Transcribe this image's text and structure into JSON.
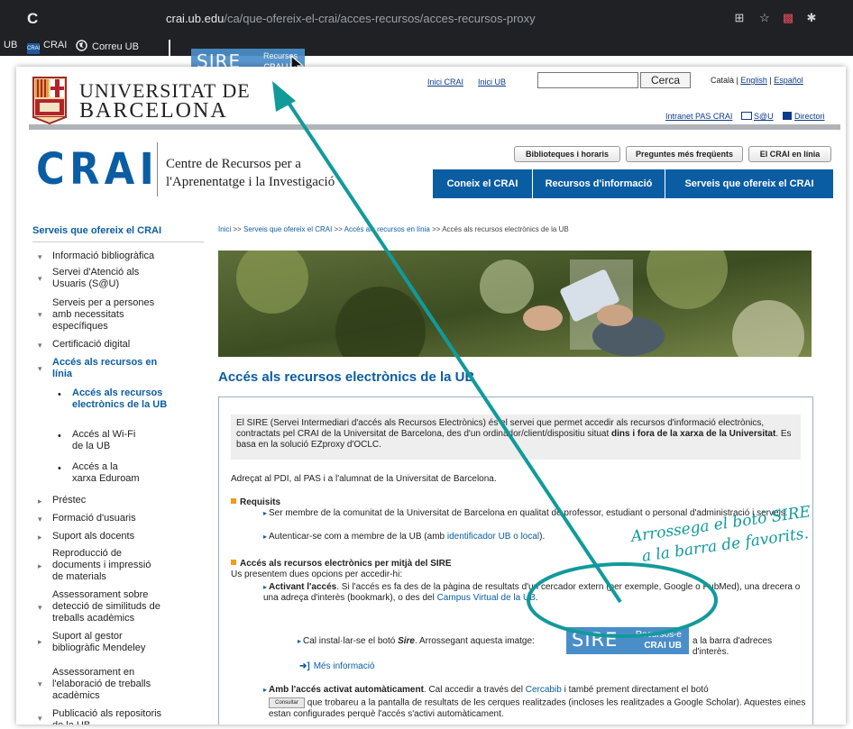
{
  "browser": {
    "url_domain": "crai.ub.edu",
    "url_path": "/ca/que-ofereix-el-crai/acces-recursos/acces-recursos-proxy",
    "bookmarks": [
      {
        "label": "UB",
        "icon": "ub-favicon"
      },
      {
        "label": "CRAI",
        "icon": "crai-favicon"
      },
      {
        "label": "Correu UB",
        "icon": "globe-icon"
      }
    ]
  },
  "dragged_button": {
    "main": "SIRE",
    "top": "Recursos",
    "bottom": "CRAI UB"
  },
  "header": {
    "university_line1": "UNIVERSITAT DE",
    "university_line2": "BARCELONA",
    "top_links": [
      "Inici CRAI",
      "Inici UB"
    ],
    "search_button": "Cerca",
    "search_value": "",
    "languages": [
      "Català",
      "English",
      "Español"
    ],
    "intranet": "Intranet PAS CRAI",
    "sau": "S@U",
    "directori": "Directori",
    "crai_logo": "CRAI",
    "crai_name_line1": "Centre de Recursos per a",
    "crai_name_line2": "l'Aprenentatge i la Investigació",
    "pills": [
      "Biblioteques i horaris",
      "Preguntes més freqüents",
      "El CRAI en línia"
    ],
    "main_nav": [
      "Coneix el CRAI",
      "Recursos d'informació",
      "Serveis que ofereix el CRAI"
    ]
  },
  "sidebar": {
    "title": "Serveis que ofereix el CRAI",
    "items": [
      {
        "label": "Informació bibliogràfica",
        "bullet": "▾"
      },
      {
        "label": "Servei d'Atenció als Usuaris (S@U)",
        "bullet": "▾"
      },
      {
        "label": "Serveis per a persones amb necessitats específiques",
        "bullet": "▾"
      },
      {
        "label": "Certificació digital",
        "bullet": "▾"
      },
      {
        "label": "Accés als recursos en línia",
        "bullet": "▾"
      },
      {
        "label": "Préstec",
        "bullet": "▸"
      },
      {
        "label": "Formació d'usuaris",
        "bullet": "▾"
      },
      {
        "label": "Suport als docents",
        "bullet": "▸"
      },
      {
        "label": "Reproducció de documents i impressió de materials",
        "bullet": "▸"
      },
      {
        "label": "Assessorament sobre detecció de similituds de treballs acadèmics",
        "bullet": "▾"
      },
      {
        "label": "Suport al gestor bibliogràfic Mendeley",
        "bullet": "▸"
      },
      {
        "label": "Assessorament en l'elaboració de treballs acadèmics",
        "bullet": "▾"
      },
      {
        "label": "Publicació als repositoris de la UB",
        "bullet": "▾"
      }
    ],
    "subitems": [
      "Accés als recursos electrònics de la UB",
      "Accés al Wi-Fi de la UB",
      "Accés a la xarxa Eduroam"
    ]
  },
  "breadcrumb": {
    "parts": [
      "Inici",
      "Serveis que ofereix el CRAI",
      "Accés als recursos en línia"
    ],
    "current": "Accés als recursos electrònics de la UB",
    "sep": ">>"
  },
  "main": {
    "title": "Accés als recursos electrònics de la UB",
    "intro_1": "El SIRE (Servei Intermediari d'accés als Recursos Electrònics) és el servei que permet accedir als recursos d'informació electrònics, contractats pel CRAI de la Universitat de Barcelona, des d'un ordinador/client/dispositiu situat",
    "intro_bold": "dins i fora de la xarxa de la Universitat",
    "intro_2": ". Es basa en la solució EZproxy d'OCLC.",
    "adrecat": "Adreçat al PDI, al PAS i a l'alumnat de la Universitat de Barcelona.",
    "req_heading": "Requisits",
    "req_1": "Ser membre de la comunitat de la Universitat de Barcelona en qualitat de professor, estudiant o personal d'administració i serveis.",
    "req_2_pre": "Autenticar-se com a membre de la UB (amb",
    "req_2_link": "identificador UB o local",
    "req_2_post": ").",
    "sire_heading": "Accés als recursos electrònics per mitjà del SIRE",
    "sire_intro": "Us presentem dues opcions per accedir-hi:",
    "opt1_bold": "Activant l'accés",
    "opt1_text": ". Si l'accés es fa des de la pàgina de resultats d'un cercador extern (per exemple, Google o PubMed), una drecera o una adreça d'interès (bookmark), o des del",
    "opt1_link": "Campus Virtual de la UB",
    "opt1_end": ".",
    "install_pre": "Cal instal·lar-se el botó",
    "install_bold": "Sire",
    "install_mid": ". Arrossegant aquesta imatge:",
    "install_post": "a la barra d'adreces d'interès.",
    "mes_info": "Més informació",
    "opt2_bold": "Amb l'accés activat automàticament",
    "opt2_text": ". Cal accedir a través del",
    "opt2_link": "Cercabib",
    "opt2_text2": "i també prement directament el botó",
    "consultar": "Consultar",
    "opt2_text3": "que trobareu a la pantalla de resultats de les cerques realitzades (incloses les realitzades a Google Scholar). Aquestes eines estan configurades perquè l'accés s'activi automàticament.",
    "sire_button": {
      "main": "SIRE",
      "top": "Recursos-e",
      "bottom": "CRAI UB"
    }
  },
  "annotation": {
    "line1": "Arrossega el botó SIRE",
    "line2": "a la barra de favorits.",
    "color": "#129a9a"
  }
}
